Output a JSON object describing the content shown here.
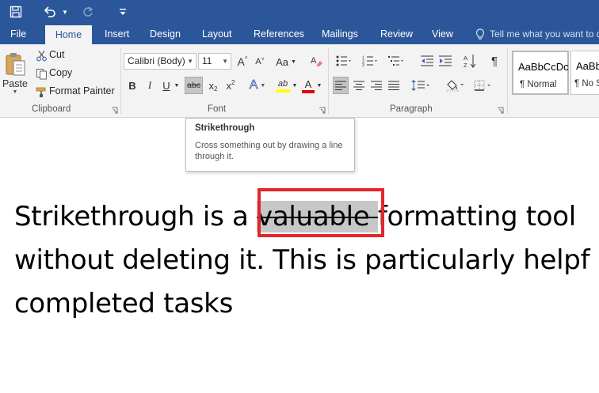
{
  "qat": {
    "save_icon": "save-icon",
    "undo_icon": "undo-icon",
    "redo_icon": "redo-icon",
    "customize_icon": "customize-qat-icon"
  },
  "tabs": {
    "file": "File",
    "home": "Home",
    "insert": "Insert",
    "design": "Design",
    "layout": "Layout",
    "references": "References",
    "mailings": "Mailings",
    "review": "Review",
    "view": "View",
    "tell_me": "Tell me what you want to d"
  },
  "clipboard": {
    "paste": "Paste",
    "cut": "Cut",
    "copy": "Copy",
    "format_painter": "Format Painter",
    "label": "Clipboard"
  },
  "font": {
    "name": "Calibri (Body)",
    "size": "11",
    "label": "Font",
    "bold": "B",
    "italic": "I",
    "underline": "U",
    "strikethrough": "abc",
    "subscript_base": "x",
    "subscript_mark": "2",
    "superscript_base": "x",
    "superscript_mark": "2",
    "grow": "A",
    "shrink": "A",
    "case": "Aa",
    "text_effects": "A",
    "highlight": "ab",
    "font_color": "A"
  },
  "paragraph": {
    "label": "Paragraph",
    "pilcrow": "¶"
  },
  "styles": {
    "normal_sample": "AaBbCcDc",
    "normal_name": "¶ Normal",
    "nospacing_sample": "AaBb",
    "nospacing_name": "¶ No S"
  },
  "tooltip": {
    "title": "Strikethrough",
    "description": "Cross something out by drawing a line through it."
  },
  "document": {
    "line1_before": "Strikethrough is a ",
    "line1_struck": "valuable ",
    "line1_after": "formatting tool",
    "line2": "without deleting it. This is particularly helpf",
    "line3": "completed tasks"
  },
  "colors": {
    "brand": "#2b579a",
    "ribbon_bg": "#f3f3f3",
    "highlight_yellow": "#ffff00",
    "font_red": "#e00000",
    "callout_red": "#e2262b"
  }
}
